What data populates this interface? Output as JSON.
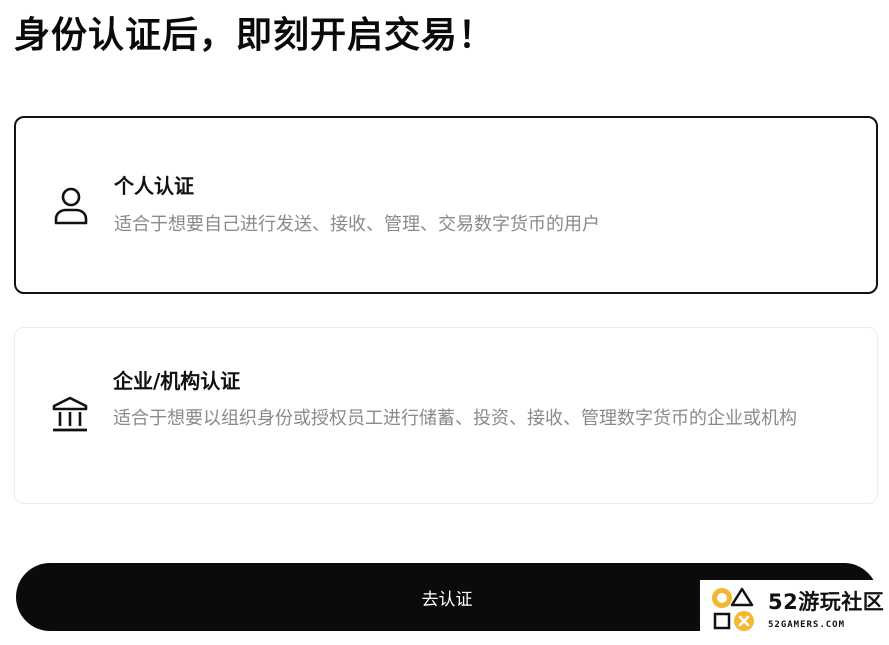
{
  "page": {
    "title": "身份认证后，即刻开启交易！"
  },
  "options": [
    {
      "id": "personal",
      "icon": "user-icon",
      "title": "个人认证",
      "description": "适合于想要自己进行发送、接收、管理、交易数字货币的用户",
      "selected": true
    },
    {
      "id": "business",
      "icon": "bank-icon",
      "title": "企业/机构认证",
      "description": "适合于想要以组织身份或授权员工进行储蓄、投资、接收、管理数字货币的企业或机构",
      "selected": false
    }
  ],
  "actions": {
    "submit_label": "去认证"
  },
  "watermark": {
    "name": "52游玩社区",
    "site": "52GAMERS.COM",
    "accent": "#f5b731"
  },
  "colors": {
    "text": "#111111",
    "secondary_text": "#8a8a8a",
    "button_bg": "#0b0b0b",
    "selected_border": "#111111",
    "card_border": "#ececec"
  }
}
